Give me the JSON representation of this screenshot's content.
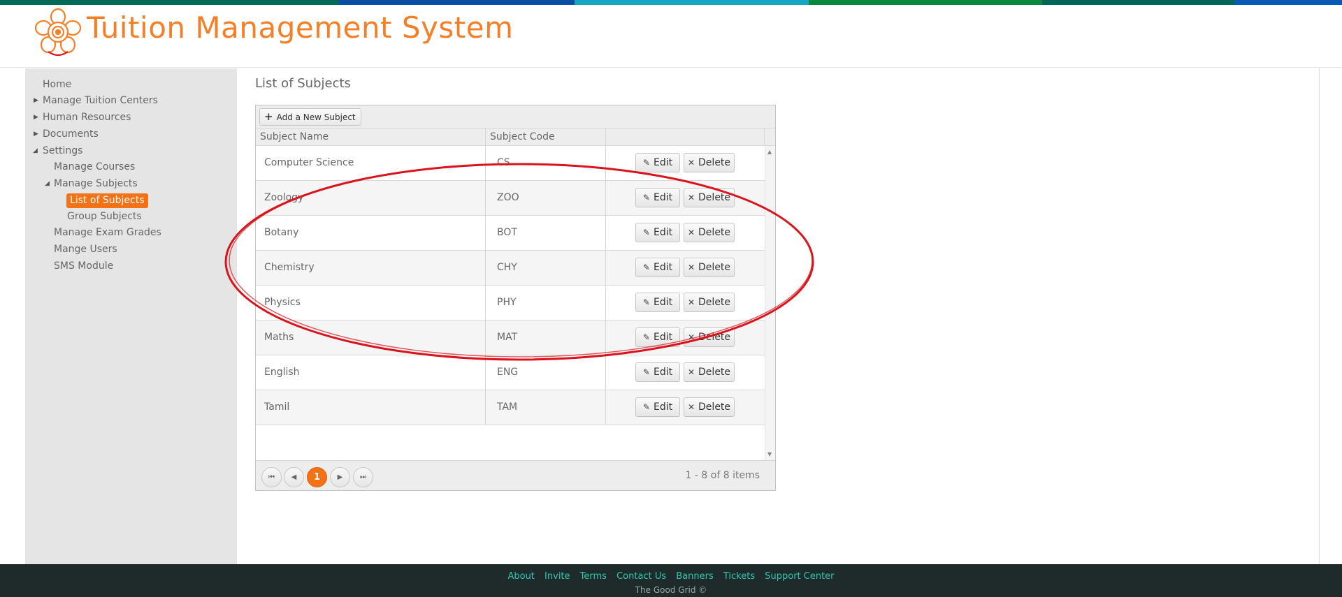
{
  "colors": {
    "accent": "#f47216",
    "title": "#f47f27",
    "topbar": [
      "#006a58",
      "#0a4fa3",
      "#16a6c2",
      "#0b8a3e",
      "#006657",
      "#0a5bb5"
    ],
    "footer_link": "#2fc6b5",
    "annotation": "#d9141c"
  },
  "header": {
    "title": "Tuition Management System",
    "logo_icon": "flower-logo-icon"
  },
  "sidebar": {
    "items": [
      {
        "label": "Home",
        "level": 0,
        "expander": ""
      },
      {
        "label": "Manage Tuition Centers",
        "level": 0,
        "expander": "collapsed"
      },
      {
        "label": "Human Resources",
        "level": 0,
        "expander": "collapsed"
      },
      {
        "label": "Documents",
        "level": 0,
        "expander": "collapsed"
      },
      {
        "label": "Settings",
        "level": 0,
        "expander": "expanded"
      },
      {
        "label": "Manage Courses",
        "level": 1,
        "expander": ""
      },
      {
        "label": "Manage Subjects",
        "level": 1,
        "expander": "expanded"
      },
      {
        "label": "List of Subjects",
        "level": 2,
        "expander": "",
        "active": true
      },
      {
        "label": "Group Subjects",
        "level": 2,
        "expander": ""
      },
      {
        "label": "Manage Exam Grades",
        "level": 1,
        "expander": ""
      },
      {
        "label": "Mange Users",
        "level": 1,
        "expander": ""
      },
      {
        "label": "SMS Module",
        "level": 1,
        "expander": ""
      }
    ]
  },
  "main": {
    "page_title": "List of Subjects",
    "add_button": "Add a New Subject",
    "columns": [
      "Subject Name",
      "Subject Code",
      ""
    ],
    "rows": [
      {
        "name": "Computer Science",
        "code": "CS"
      },
      {
        "name": "Zoology",
        "code": "ZOO"
      },
      {
        "name": "Botany",
        "code": "BOT"
      },
      {
        "name": "Chemistry",
        "code": "CHY"
      },
      {
        "name": "Physics",
        "code": "PHY"
      },
      {
        "name": "Maths",
        "code": "MAT"
      },
      {
        "name": "English",
        "code": "ENG"
      },
      {
        "name": "Tamil",
        "code": "TAM"
      }
    ],
    "edit_label": "Edit",
    "delete_label": "Delete",
    "pager": {
      "current_page": "1",
      "info": "1 - 8 of 8 items"
    }
  },
  "footer": {
    "links": [
      "About",
      "Invite",
      "Terms",
      "Contact Us",
      "Banners",
      "Tickets",
      "Support Center"
    ],
    "copyright": "The Good Grid ©"
  }
}
